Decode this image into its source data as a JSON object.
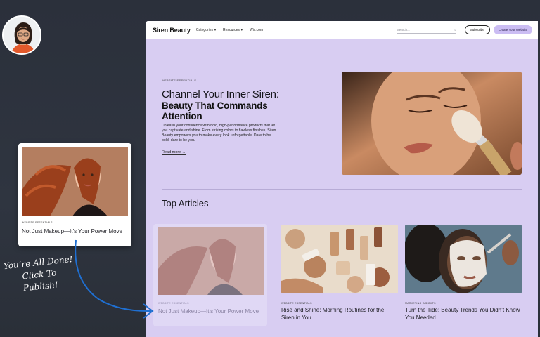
{
  "site": {
    "logo": "Siren Beauty",
    "nav": {
      "categories": "Categories",
      "resources": "Resources",
      "wix": "Wix.com",
      "search_placeholder": "Search...",
      "subscribe": "Subscribe",
      "create": "Create Your Website"
    },
    "hero": {
      "eyebrow": "WEBSITE ESSENTIALS",
      "title_line1": "Channel Your Inner Siren:",
      "title_line2": "Beauty That Commands Attention",
      "body": "Unleash your confidence with bold, high-performance products that let you captivate and shine. From striking colors to flawless finishes, Siren Beauty empowers you to make every look unforgettable. Dare to be bold, dare to be you.",
      "read_more": "Read more →"
    },
    "top_articles": {
      "heading": "Top Articles",
      "cards": [
        {
          "eyebrow": "WEBSITE ESSENTIALS",
          "title": "Rise and Shine: Morning Routines for the Siren in You"
        },
        {
          "eyebrow": "MARKETING INSIGHTS",
          "title": "Turn the Tide: Beauty Trends You Didn’t Know You Needed"
        }
      ],
      "ghost_card": {
        "eyebrow": "WEBSITE ESSENTIALS",
        "title": "Not Just Makeup—It’s Your Power Move"
      }
    }
  },
  "dragged_card": {
    "eyebrow": "WEBSITE ESSENTIALS",
    "title": "Not Just Makeup—It’s Your Power Move"
  },
  "annotation": {
    "line1": "You’re All Done!",
    "line2": "Click To Publish!"
  },
  "colors": {
    "page_bg": "#2b303b",
    "site_bg": "#d8cdf2",
    "accent_button": "#cbbdf3",
    "arrow": "#1f6fd1"
  },
  "icons": {
    "search": "search-icon",
    "caret": "chevron-down-icon",
    "arrow": "curved-arrow-icon"
  }
}
